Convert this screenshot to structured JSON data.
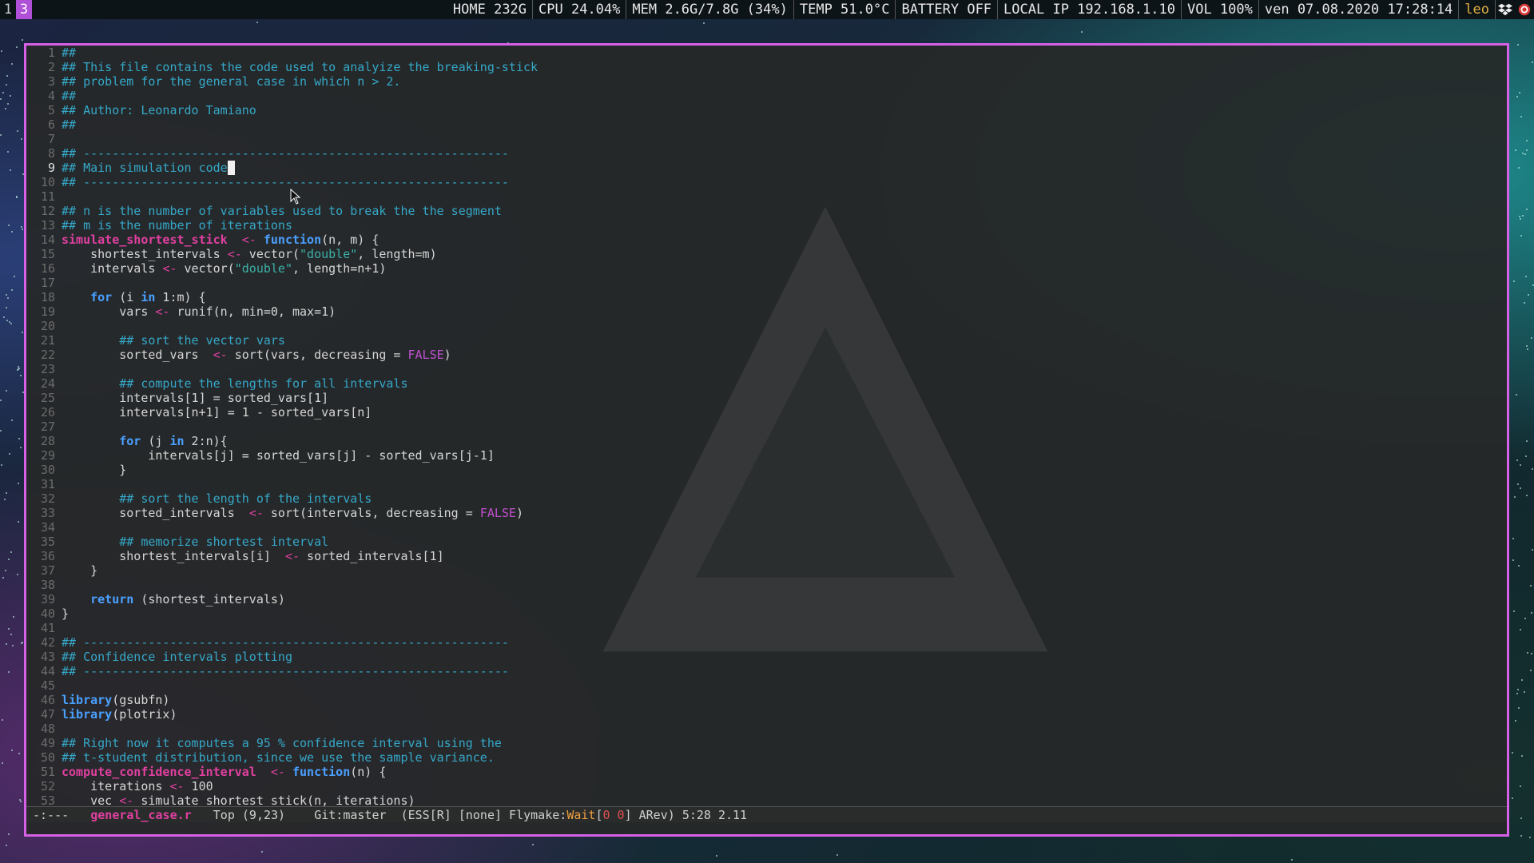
{
  "topbar": {
    "workspaces": [
      {
        "label": "1",
        "active": false
      },
      {
        "label": "3",
        "active": true
      }
    ],
    "status": [
      {
        "name": "home",
        "text": "HOME 232G"
      },
      {
        "name": "cpu",
        "text": "CPU 24.04%"
      },
      {
        "name": "mem",
        "text": "MEM 2.6G/7.8G (34%)"
      },
      {
        "name": "temp",
        "text": "TEMP 51.0°C"
      },
      {
        "name": "battery",
        "text": "BATTERY OFF"
      },
      {
        "name": "ip",
        "text": "LOCAL IP 192.168.1.10"
      },
      {
        "name": "vol",
        "text": "VOL 100%"
      },
      {
        "name": "datetime",
        "text": "ven 07.08.2020 17:28:14"
      }
    ],
    "user": "leo",
    "tray_icons": [
      "dropbox-icon",
      "red-circle-app-icon"
    ]
  },
  "editor": {
    "border_color": "#d660e6",
    "current_line": 9,
    "cursor_column": 23,
    "lines": [
      [
        {
          "t": "##",
          "c": "c"
        }
      ],
      [
        {
          "t": "## This file contains the code used to analyize the breaking-stick",
          "c": "c"
        }
      ],
      [
        {
          "t": "## problem for the general case in which n > 2.",
          "c": "c"
        }
      ],
      [
        {
          "t": "##",
          "c": "c"
        }
      ],
      [
        {
          "t": "## Author: Leonardo Tamiano",
          "c": "c"
        }
      ],
      [
        {
          "t": "##",
          "c": "c"
        }
      ],
      [],
      [
        {
          "t": "## -----------------------------------------------------------",
          "c": "c"
        }
      ],
      [
        {
          "t": "## Main simulation code",
          "c": "c"
        }
      ],
      [
        {
          "t": "## -----------------------------------------------------------",
          "c": "c"
        }
      ],
      [],
      [
        {
          "t": "## n is the number of variables used to break the the segment",
          "c": "c"
        }
      ],
      [
        {
          "t": "## m is the number of iterations",
          "c": "c"
        }
      ],
      [
        {
          "t": "simulate_shortest_stick",
          "c": "f"
        },
        {
          "t": "  "
        },
        {
          "t": "<-",
          "c": "o"
        },
        {
          "t": " "
        },
        {
          "t": "function",
          "c": "k"
        },
        {
          "t": "(n, m) {"
        }
      ],
      [
        {
          "t": "    shortest_intervals "
        },
        {
          "t": "<-",
          "c": "o"
        },
        {
          "t": " vector("
        },
        {
          "t": "\"double\"",
          "c": "s"
        },
        {
          "t": ", length=m)"
        }
      ],
      [
        {
          "t": "    intervals "
        },
        {
          "t": "<-",
          "c": "o"
        },
        {
          "t": " vector("
        },
        {
          "t": "\"double\"",
          "c": "s"
        },
        {
          "t": ", length=n+1)"
        }
      ],
      [],
      [
        {
          "t": "    "
        },
        {
          "t": "for",
          "c": "k"
        },
        {
          "t": " (i "
        },
        {
          "t": "in",
          "c": "k"
        },
        {
          "t": " 1:m) {"
        }
      ],
      [
        {
          "t": "        vars "
        },
        {
          "t": "<-",
          "c": "o"
        },
        {
          "t": " runif(n, min=0, max=1)"
        }
      ],
      [],
      [
        {
          "t": "        "
        },
        {
          "t": "## sort the vector vars",
          "c": "c"
        }
      ],
      [
        {
          "t": "        sorted_vars  "
        },
        {
          "t": "<-",
          "c": "o"
        },
        {
          "t": " sort(vars, decreasing = "
        },
        {
          "t": "FALSE",
          "c": "b"
        },
        {
          "t": ")"
        }
      ],
      [],
      [
        {
          "t": "        "
        },
        {
          "t": "## compute the lengths for all intervals",
          "c": "c"
        }
      ],
      [
        {
          "t": "        intervals[1] = sorted_vars[1]"
        }
      ],
      [
        {
          "t": "        intervals[n+1] = 1 - sorted_vars[n]"
        }
      ],
      [],
      [
        {
          "t": "        "
        },
        {
          "t": "for",
          "c": "k"
        },
        {
          "t": " (j "
        },
        {
          "t": "in",
          "c": "k"
        },
        {
          "t": " 2:n){"
        }
      ],
      [
        {
          "t": "            intervals[j] = sorted_vars[j] - sorted_vars[j-1]"
        }
      ],
      [
        {
          "t": "        }"
        }
      ],
      [],
      [
        {
          "t": "        "
        },
        {
          "t": "## sort the length of the intervals",
          "c": "c"
        }
      ],
      [
        {
          "t": "        sorted_intervals  "
        },
        {
          "t": "<-",
          "c": "o"
        },
        {
          "t": " sort(intervals, decreasing = "
        },
        {
          "t": "FALSE",
          "c": "b"
        },
        {
          "t": ")"
        }
      ],
      [],
      [
        {
          "t": "        "
        },
        {
          "t": "## memorize shortest interval",
          "c": "c"
        }
      ],
      [
        {
          "t": "        shortest_intervals[i]  "
        },
        {
          "t": "<-",
          "c": "o"
        },
        {
          "t": " sorted_intervals[1]"
        }
      ],
      [
        {
          "t": "    }"
        }
      ],
      [],
      [
        {
          "t": "    "
        },
        {
          "t": "return",
          "c": "k"
        },
        {
          "t": " (shortest_intervals)"
        }
      ],
      [
        {
          "t": "}"
        }
      ],
      [],
      [
        {
          "t": "## -----------------------------------------------------------",
          "c": "c"
        }
      ],
      [
        {
          "t": "## Confidence intervals plotting",
          "c": "c"
        }
      ],
      [
        {
          "t": "## -----------------------------------------------------------",
          "c": "c"
        }
      ],
      [],
      [
        {
          "t": "library",
          "c": "k"
        },
        {
          "t": "(gsubfn)"
        }
      ],
      [
        {
          "t": "library",
          "c": "k"
        },
        {
          "t": "(plotrix)"
        }
      ],
      [],
      [
        {
          "t": "## Right now it computes a 95 % confidence interval using the",
          "c": "c"
        }
      ],
      [
        {
          "t": "## t-student distribution, since we use the sample variance.",
          "c": "c"
        }
      ],
      [
        {
          "t": "compute_confidence_interval",
          "c": "f"
        },
        {
          "t": "  "
        },
        {
          "t": "<-",
          "c": "o"
        },
        {
          "t": " "
        },
        {
          "t": "function",
          "c": "k"
        },
        {
          "t": "(n) {"
        }
      ],
      [
        {
          "t": "    iterations "
        },
        {
          "t": "<-",
          "c": "o"
        },
        {
          "t": " 100"
        }
      ],
      [
        {
          "t": "    vec "
        },
        {
          "t": "<-",
          "c": "o"
        },
        {
          "t": " simulate_shortest_stick(n, iterations)"
        }
      ]
    ]
  },
  "modeline": {
    "state": "-:---",
    "filename": "general_case.r",
    "position": "Top (9,23)",
    "vcs": "Git:master",
    "modes_prefix": "(ESS[R] [none] Flymake:",
    "flymake_status": "Wait",
    "flymake_open": "[",
    "flymake_counts": "0 0",
    "flymake_close": "]",
    "modes_suffix": " ARev)",
    "column_info": "5:28 2.11"
  }
}
